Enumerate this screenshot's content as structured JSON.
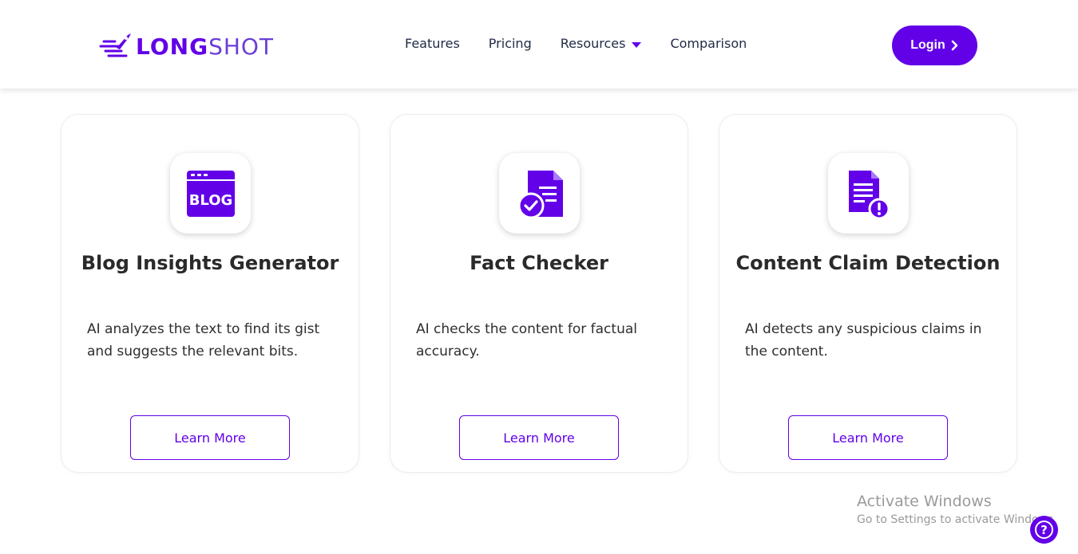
{
  "brand": {
    "logo_part1": "LONG",
    "logo_part2": "SHOT",
    "accent": "#6200e8"
  },
  "nav": {
    "items": [
      {
        "label": "Features"
      },
      {
        "label": "Pricing"
      },
      {
        "label": "Resources",
        "has_dropdown": true
      },
      {
        "label": "Comparison"
      }
    ],
    "login_label": "Login",
    "login_icon": "chevron-right-icon"
  },
  "cards": [
    {
      "icon": "blog-window-icon",
      "icon_text": "BLOG",
      "title": "Blog Insights Generator",
      "description": "AI analyzes the text to find its gist and suggests the relevant bits.",
      "button_label": "Learn More"
    },
    {
      "icon": "document-check-icon",
      "title": "Fact Checker",
      "description": "AI checks the content for factual accuracy.",
      "button_label": "Learn More"
    },
    {
      "icon": "document-alert-icon",
      "title": "Content Claim Detection",
      "description": "AI detects any suspicious claims in the content.",
      "button_label": "Learn More"
    }
  ],
  "watermark": {
    "title": "Activate Windows",
    "subtitle": "Go to Settings to activate Windows."
  },
  "help": {
    "icon": "question-icon",
    "glyph": "?"
  }
}
